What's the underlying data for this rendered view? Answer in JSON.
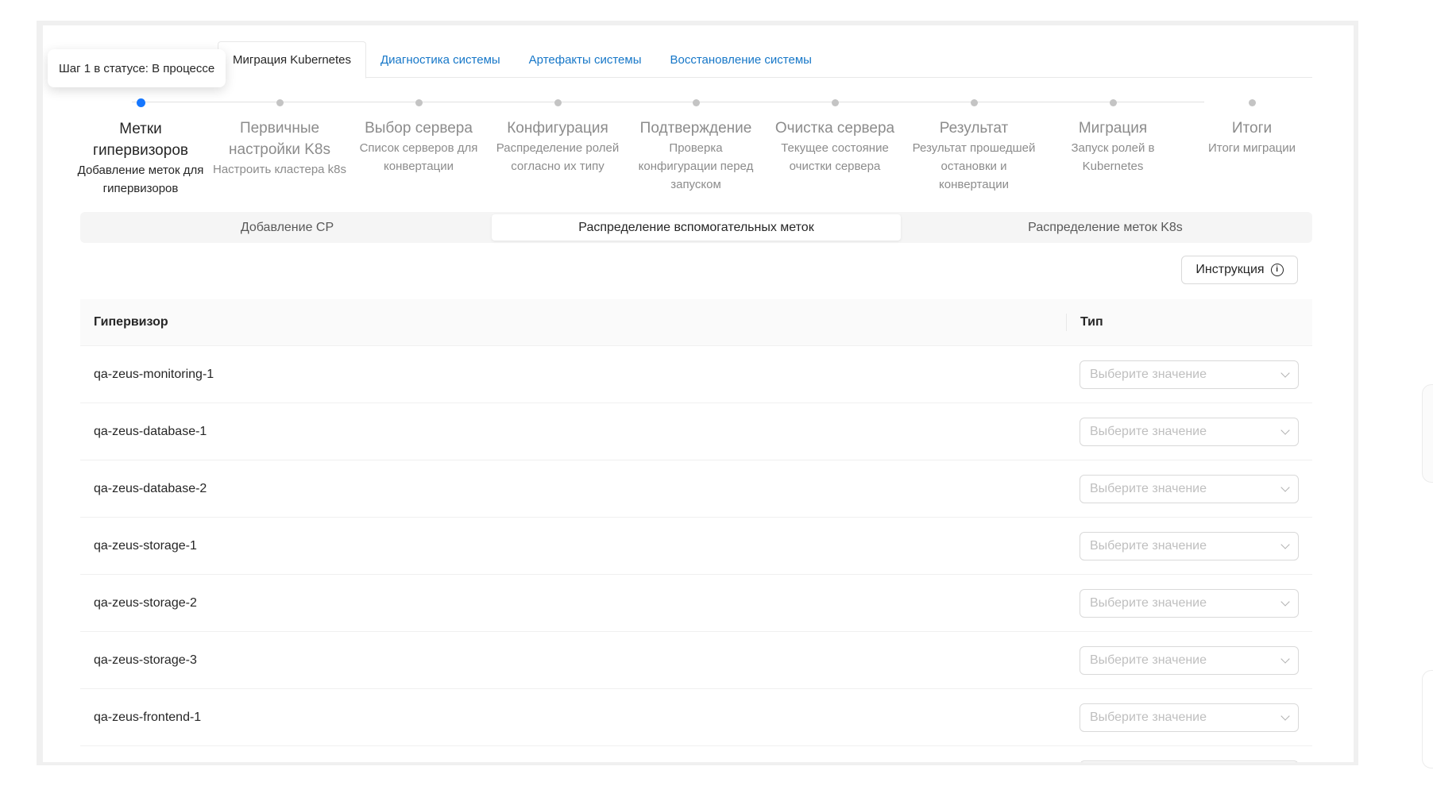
{
  "tooltip": "Шаг 1 в статусе: В процессе",
  "tabs": [
    {
      "label": "Миграция Kubernetes"
    },
    {
      "label": "Диагностика системы"
    },
    {
      "label": "Артефакты системы"
    },
    {
      "label": "Восстановление системы"
    }
  ],
  "steps": [
    {
      "title": "Метки гипервизоров",
      "desc": "Добавление меток для гипервизоров"
    },
    {
      "title": "Первичные настройки K8s",
      "desc": "Настроить кластера k8s"
    },
    {
      "title": "Выбор сервера",
      "desc": "Список серверов для конвертации"
    },
    {
      "title": "Конфигурация",
      "desc": "Распределение ролей согласно их типу"
    },
    {
      "title": "Подтверждение",
      "desc": "Проверка конфигурации перед запуском"
    },
    {
      "title": "Очистка сервера",
      "desc": "Текущее состояние очистки сервера"
    },
    {
      "title": "Результат",
      "desc": "Результат прошедшей остановки и конвертации"
    },
    {
      "title": "Миграция",
      "desc": "Запуск ролей в Kubernetes"
    },
    {
      "title": "Итоги",
      "desc": "Итоги миграции"
    }
  ],
  "segments": [
    {
      "label": "Добавление CP"
    },
    {
      "label": "Распределение вспомогательных меток"
    },
    {
      "label": "Распределение меток K8s"
    }
  ],
  "instruction_button": "Инструкция",
  "table": {
    "headers": {
      "hypervisor": "Гипервизор",
      "type": "Тип"
    },
    "placeholder": "Выберите значение",
    "rows": [
      {
        "name": "qa-zeus-monitoring-1"
      },
      {
        "name": "qa-zeus-database-1"
      },
      {
        "name": "qa-zeus-database-2"
      },
      {
        "name": "qa-zeus-storage-1"
      },
      {
        "name": "qa-zeus-storage-2"
      },
      {
        "name": "qa-zeus-storage-3"
      },
      {
        "name": "qa-zeus-frontend-1"
      }
    ]
  },
  "colors": {
    "accent": "#1677ff",
    "link": "#1677c8",
    "muted": "#8c8c8c"
  },
  "icons": {
    "info": "info-circle-icon",
    "select_arrow": "chevron-down-icon"
  }
}
